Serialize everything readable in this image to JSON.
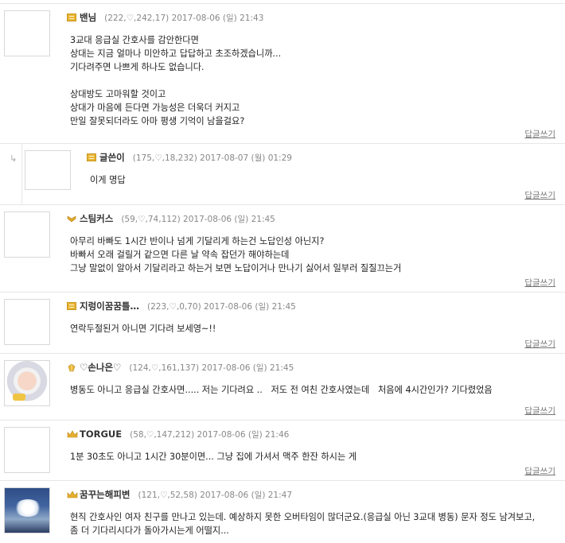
{
  "reply_link_label": "답글쓰기",
  "colors": {
    "level_gold": "#e8b534",
    "meta_gray": "#888888",
    "border": "#e6e6e6"
  },
  "comments": [
    {
      "nickname": "밴님",
      "meta": "(222,♡,242,17) 2017-08-06 (일) 21:43",
      "level_icon": "gold-bar-icon",
      "lines": "3교대 응급실 간호사를 감안한다면\n상대는 지금 얼마나 미안하고 답답하고 초조하겠습니까...\n기다려주면 나쁘게 하나도 없습니다.\n\n상대방도 고마워할 것이고\n상대가 마음에 든다면 가능성은 더욱더 커지고\n만일 잘못되더라도 아마 평생 기억이 남을걸요?"
    },
    {
      "nickname": "글쓴이",
      "meta": "(175,♡,18,232) 2017-08-07 (월) 01:29",
      "level_icon": "gold-bar-icon",
      "lines": "이게 명답"
    },
    {
      "nickname": "스팀커스",
      "meta": "(59,♡,74,112) 2017-08-06 (일) 21:45",
      "level_icon": "gold-chevron-icon",
      "lines": "아무리 바빠도 1시간 반이나 넘게 기달리게 하는건 노답인성 아닌지?\n바빠서 오래 걸릴거 같으면 다른 날 약속 잡던가 해야하는데\n그냥 말없이 알아서 기달리라고 하는거 보면 노답이거나 만나기 싫어서 일부러 질질끄는거"
    },
    {
      "nickname": "지렁이꿈꿈틀…",
      "meta": "(223,♡,0,70) 2017-08-06 (일) 21:45",
      "level_icon": "gold-bar-icon",
      "lines": "연락두절된거 아니면 기다려 보세영~!!"
    },
    {
      "nickname": "♡손나은♡",
      "meta": "(124,♡,161,137) 2017-08-06 (일) 21:45",
      "level_icon": "gold-gem-icon",
      "lines": "병동도 아니고 응급실 간호사면..... 저는 기다려요 ..   저도 전 여친 간호사였는데   처음에 4시간인가? 기다렸었음"
    },
    {
      "nickname": "TORGUE",
      "meta": "(58,♡,147,212) 2017-08-06 (일) 21:46",
      "level_icon": "gold-crown-icon",
      "lines": "1분 30초도 아니고 1시간 30분이면... 그냥 집에 가셔서 맥주 한잔 하시는 게"
    },
    {
      "nickname": "꿈꾸는해피변",
      "meta": "(121,♡,52,58) 2017-08-06 (일) 21:47",
      "level_icon": "gold-crown-icon",
      "lines": "현직 간호사인 여자 친구를 만나고 있는데. 예상하지 못한 오버타임이 많더군요.(응급실 아닌 3교대 병동) 문자 정도 남겨보고,\n좀 더 기다리시다가 돌아가시는게 어떨지..."
    }
  ]
}
